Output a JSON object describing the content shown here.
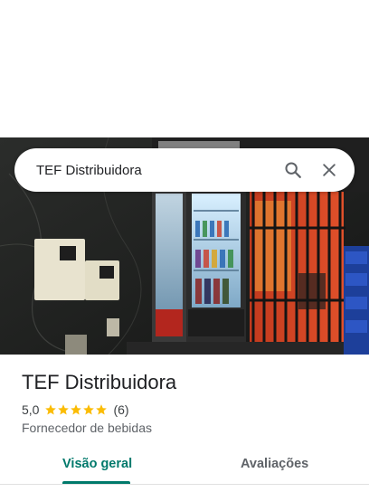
{
  "search": {
    "query": "TEF Distribuidora",
    "search_icon": "search-icon",
    "close_icon": "close-icon"
  },
  "place": {
    "name": "TEF Distribuidora",
    "rating": "5,0",
    "stars": 5,
    "review_count": "(6)",
    "category": "Fornecedor de bebidas"
  },
  "tabs": [
    {
      "label": "Visão geral",
      "active": true
    },
    {
      "label": "Avaliações",
      "active": false
    }
  ],
  "colors": {
    "accent": "#00796b",
    "star": "#fbbc04"
  }
}
